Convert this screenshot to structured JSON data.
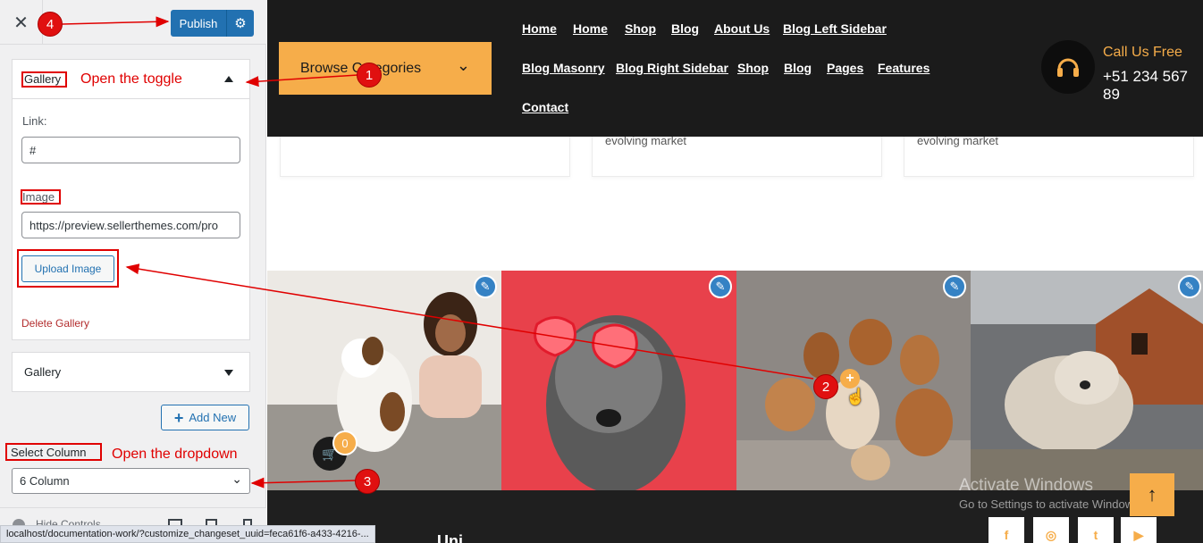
{
  "sidebar": {
    "close_symbol": "✕",
    "publish_label": "Publish",
    "gallery_panel_title": "Gallery",
    "link_label": "Link:",
    "link_value": "#",
    "image_label": "Image :",
    "image_value": "https://preview.sellerthemes.com/pro",
    "upload_label": "Upload Image",
    "delete_label": "Delete Gallery",
    "gallery_panel_2_title": "Gallery",
    "add_new_label": "Add New",
    "select_column_label": "Select Column",
    "select_column_value": "6 Column",
    "hide_controls_label": "Hide Controls",
    "status_url": "localhost/documentation-work/?customize_changeset_uuid=feca61f6-a433-4216-..."
  },
  "preview": {
    "browse_categories": "Browse Categories",
    "nav_row1": [
      "Home",
      "Home",
      "Shop",
      "Blog",
      "About Us",
      "Blog Left Sidebar"
    ],
    "nav_row2": [
      "Blog Masonry",
      "Blog Right Sidebar",
      "Shop",
      "Blog",
      "Pages",
      "Features"
    ],
    "nav_row3": [
      "Contact"
    ],
    "call_title": "Call Us Free",
    "call_number": "+51 234 567 89",
    "card_text": "evolving market",
    "cart_count": "0",
    "activate_line1": "Activate Windows",
    "activate_line2": "Go to Settings to activate Windows.",
    "social": [
      "f",
      "◎",
      "t",
      "▶"
    ],
    "footer_title": "...Uni"
  },
  "annotations": {
    "open_toggle": "Open the toggle",
    "open_dropdown": "Open the dropdown",
    "badges": [
      "1",
      "2",
      "3",
      "4"
    ]
  },
  "colors": {
    "accent": "#f6ad4a",
    "wp_blue": "#2271b1",
    "annotation_red": "#e00000",
    "dark": "#1b1b1b"
  }
}
